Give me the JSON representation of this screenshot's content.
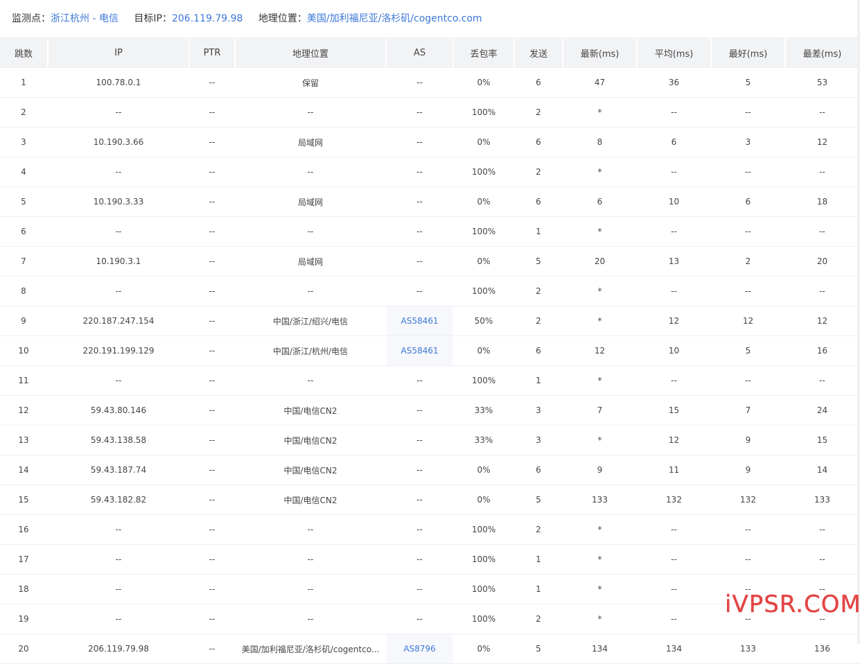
{
  "header": {
    "monitor_label": "监测点：",
    "monitor_value": "浙江杭州 - 电信",
    "target_label": "目标IP：",
    "target_value": "206.119.79.98",
    "geo_label": "地理位置：",
    "geo_value": "美国/加利福尼亚/洛杉矶/cogentco.com"
  },
  "columns": [
    "跳数",
    "IP",
    "PTR",
    "地理位置",
    "AS",
    "丢包率",
    "发送",
    "最新(ms)",
    "平均(ms)",
    "最好(ms)",
    "最差(ms)"
  ],
  "rows": [
    [
      "1",
      "100.78.0.1",
      "--",
      "保留",
      "--",
      "0%",
      "6",
      "47",
      "36",
      "5",
      "53"
    ],
    [
      "2",
      "--",
      "--",
      "--",
      "--",
      "100%",
      "2",
      "*",
      "--",
      "--",
      "--"
    ],
    [
      "3",
      "10.190.3.66",
      "--",
      "局域网",
      "--",
      "0%",
      "6",
      "8",
      "6",
      "3",
      "12"
    ],
    [
      "4",
      "--",
      "--",
      "--",
      "--",
      "100%",
      "2",
      "*",
      "--",
      "--",
      "--"
    ],
    [
      "5",
      "10.190.3.33",
      "--",
      "局域网",
      "--",
      "0%",
      "6",
      "6",
      "10",
      "6",
      "18"
    ],
    [
      "6",
      "--",
      "--",
      "--",
      "--",
      "100%",
      "1",
      "*",
      "--",
      "--",
      "--"
    ],
    [
      "7",
      "10.190.3.1",
      "--",
      "局域网",
      "--",
      "0%",
      "5",
      "20",
      "13",
      "2",
      "20"
    ],
    [
      "8",
      "--",
      "--",
      "--",
      "--",
      "100%",
      "2",
      "*",
      "--",
      "--",
      "--"
    ],
    [
      "9",
      "220.187.247.154",
      "--",
      "中国/浙江/绍兴/电信",
      "AS58461",
      "50%",
      "2",
      "*",
      "12",
      "12",
      "12"
    ],
    [
      "10",
      "220.191.199.129",
      "--",
      "中国/浙江/杭州/电信",
      "AS58461",
      "0%",
      "6",
      "12",
      "10",
      "5",
      "16"
    ],
    [
      "11",
      "--",
      "--",
      "--",
      "--",
      "100%",
      "1",
      "*",
      "--",
      "--",
      "--"
    ],
    [
      "12",
      "59.43.80.146",
      "--",
      "中国/电信CN2",
      "--",
      "33%",
      "3",
      "7",
      "15",
      "7",
      "24"
    ],
    [
      "13",
      "59.43.138.58",
      "--",
      "中国/电信CN2",
      "--",
      "33%",
      "3",
      "*",
      "12",
      "9",
      "15"
    ],
    [
      "14",
      "59.43.187.74",
      "--",
      "中国/电信CN2",
      "--",
      "0%",
      "6",
      "9",
      "11",
      "9",
      "14"
    ],
    [
      "15",
      "59.43.182.82",
      "--",
      "中国/电信CN2",
      "--",
      "0%",
      "5",
      "133",
      "132",
      "132",
      "133"
    ],
    [
      "16",
      "--",
      "--",
      "--",
      "--",
      "100%",
      "2",
      "*",
      "--",
      "--",
      "--"
    ],
    [
      "17",
      "--",
      "--",
      "--",
      "--",
      "100%",
      "1",
      "*",
      "--",
      "--",
      "--"
    ],
    [
      "18",
      "--",
      "--",
      "--",
      "--",
      "100%",
      "1",
      "*",
      "--",
      "--",
      "--"
    ],
    [
      "19",
      "--",
      "--",
      "--",
      "--",
      "100%",
      "2",
      "*",
      "--",
      "--",
      "--"
    ],
    [
      "20",
      "206.119.79.98",
      "--",
      "美国/加利福尼亚/洛杉矶/cogentco...",
      "AS8796",
      "0%",
      "5",
      "134",
      "134",
      "133",
      "136"
    ]
  ],
  "watermark": "iVPSR.COM",
  "colors": {
    "link": "#3c78d8",
    "header_bg": "#f2f3f5",
    "watermark": "#e03030"
  }
}
